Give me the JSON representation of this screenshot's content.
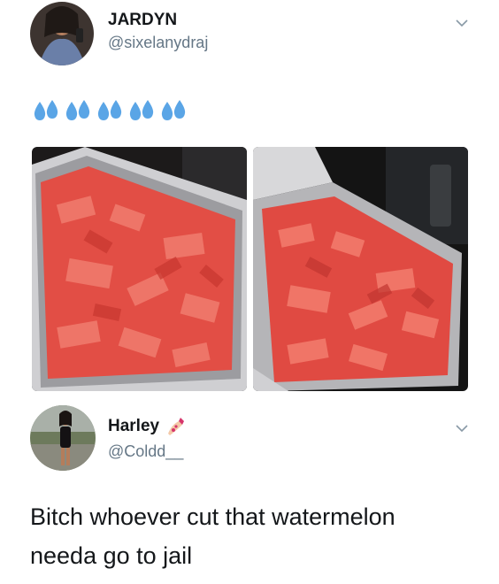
{
  "tweet1": {
    "display_name": "JARDYN",
    "handle": "@sixelanydraj",
    "emoji_text": "💦💦💦💦💦",
    "icons": [
      "sweat-droplets-icon",
      "chevron-down-icon"
    ],
    "photos": [
      "watermelon-tray-photo-left",
      "watermelon-tray-photo-right"
    ]
  },
  "tweet2": {
    "display_name": "Harley",
    "name_emoji": "💅",
    "handle": "@Coldd__",
    "text_line1": "Bitch whoever cut that watermelon",
    "text_line2": "needa go to jail",
    "icons": [
      "nail-polish-icon",
      "chevron-down-icon"
    ]
  },
  "colors": {
    "text": "#14171a",
    "handle": "#657786",
    "droplet": "#5aa5e6",
    "watermelon": "#e8504a",
    "foil": "#c9c9cc"
  }
}
